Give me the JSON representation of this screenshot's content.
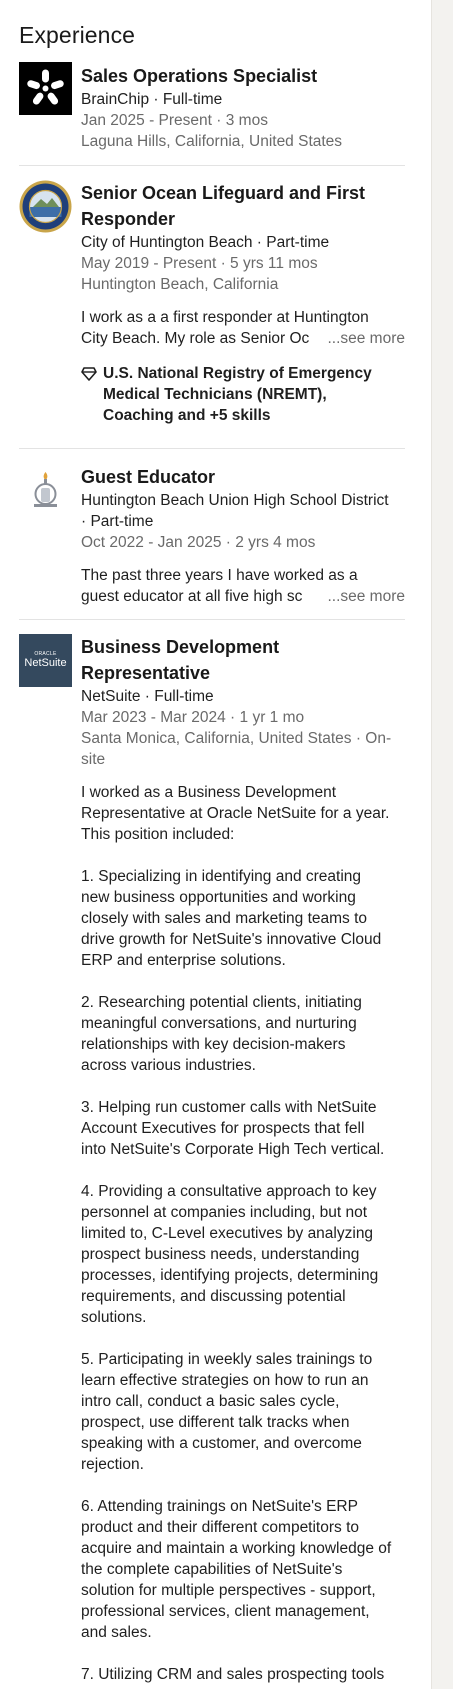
{
  "section": {
    "title": "Experience"
  },
  "entries": [
    {
      "title": "Sales Operations Specialist",
      "company": "BrainChip · Full-time",
      "dates": "Jan 2025 - Present · 3 mos",
      "location": "Laguna Hills, California, United States",
      "logo_icon": "brainchip-logo-icon"
    },
    {
      "title_line1": "Senior Ocean Lifeguard and First",
      "title_line2": "Responder",
      "company": "City of Huntington Beach · Part-time",
      "dates": "May 2019 - Present · 5 yrs 11 mos",
      "location": "Huntington Beach, California",
      "desc_line1": "I work as a a first responder at Huntington",
      "desc_line2": "City Beach. My role as Senior Oc",
      "see_more": "...see more",
      "skills_line1": "U.S. National Registry of Emergency",
      "skills_line2": "Medical Technicians (NREMT),",
      "skills_line3": "Coaching and +5 skills",
      "logo_icon": "city-seal-icon"
    },
    {
      "title": "Guest Educator",
      "company_line1": "Huntington Beach Union High School District",
      "company_line2": "· Part-time",
      "dates": "Oct 2022 - Jan 2025 · 2 yrs 4 mos",
      "desc_line1": "The past three years I have worked as a",
      "desc_line2": "guest educator at all five high sc",
      "see_more": "...see more",
      "logo_icon": "school-district-logo-icon"
    },
    {
      "title_line1": "Business Development",
      "title_line2": "Representative",
      "company": "NetSuite · Full-time",
      "dates": "Mar 2023 - Mar 2024 · 1 yr 1 mo",
      "location_line1": "Santa Monica, California, United States · On-",
      "location_line2": "site",
      "logo_small": "ORACLE",
      "logo_big": "NetSuite",
      "logo_color": "#34495e",
      "paragraphs": [
        [
          "I worked as a Business Development",
          "Representative at Oracle NetSuite for a year.",
          "This position included:"
        ],
        [
          "1. Specializing in identifying and creating",
          "new business opportunities and working",
          "closely with sales and marketing teams to",
          "drive growth for NetSuite's innovative Cloud",
          "ERP and enterprise solutions."
        ],
        [
          "2. Researching potential clients, initiating",
          "meaningful conversations, and nurturing",
          "relationships with key decision-makers",
          "across various industries."
        ],
        [
          "3. Helping run customer calls with NetSuite",
          "Account Executives for prospects that fell",
          "into NetSuite's Corporate High Tech vertical."
        ],
        [
          "4. Providing a consultative approach to key",
          "personnel at companies including, but not",
          "limited to, C-Level executives by analyzing",
          "prospect business needs, understanding",
          "processes, identifying projects, determining",
          "requirements, and discussing potential",
          "solutions."
        ],
        [
          "5. Participating in weekly sales trainings to",
          "learn effective strategies on how to run an",
          "intro call, conduct a basic sales cycle,",
          "prospect, use different talk tracks when",
          "speaking with a customer, and overcome",
          "rejection."
        ],
        [
          "6. Attending trainings on NetSuite's ERP",
          "product and their different competitors to",
          "acquire and maintain a working knowledge of",
          "the complete capabilities of NetSuite's",
          "solution for multiple perspectives - support,",
          "professional services, client management,",
          "and sales."
        ],
        [
          "7. Utilizing CRM and sales prospecting tools"
        ]
      ]
    }
  ]
}
